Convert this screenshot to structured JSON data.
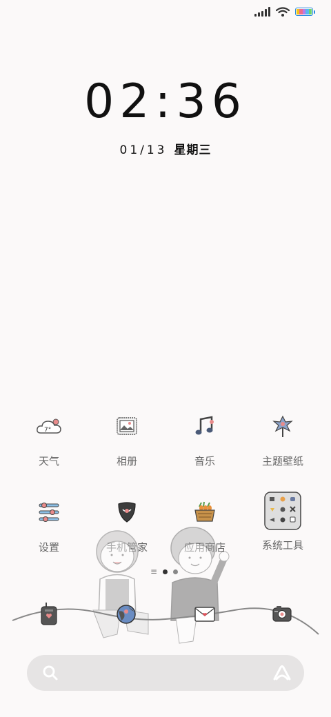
{
  "status_bar": {
    "icons": [
      "signal-icon",
      "wifi-icon",
      "battery-icon"
    ]
  },
  "clock": {
    "time": "02:36",
    "date": "01/13",
    "weekday": "星期三"
  },
  "apps": [
    {
      "label": "天气",
      "icon": "weather-cloud-icon"
    },
    {
      "label": "相册",
      "icon": "gallery-icon"
    },
    {
      "label": "音乐",
      "icon": "music-note-icon"
    },
    {
      "label": "主题壁纸",
      "icon": "theme-flower-icon"
    },
    {
      "label": "设置",
      "icon": "settings-sliders-icon"
    },
    {
      "label": "手机管家",
      "icon": "security-shield-icon"
    },
    {
      "label": "应用商店",
      "icon": "app-store-basket-icon"
    },
    {
      "label": "系统工具",
      "icon": "system-tools-folder-icon"
    }
  ],
  "weather_icon_text": "7°",
  "dock": [
    {
      "icon": "phone-icon"
    },
    {
      "icon": "browser-globe-icon"
    },
    {
      "icon": "messages-envelope-icon"
    },
    {
      "icon": "camera-icon"
    }
  ],
  "pager": {
    "pages": 2,
    "current": 1
  },
  "colors": {
    "background": "#fbf9f9",
    "search_bar": "#e6e4e4",
    "battery_outline": "#2a8de0"
  }
}
